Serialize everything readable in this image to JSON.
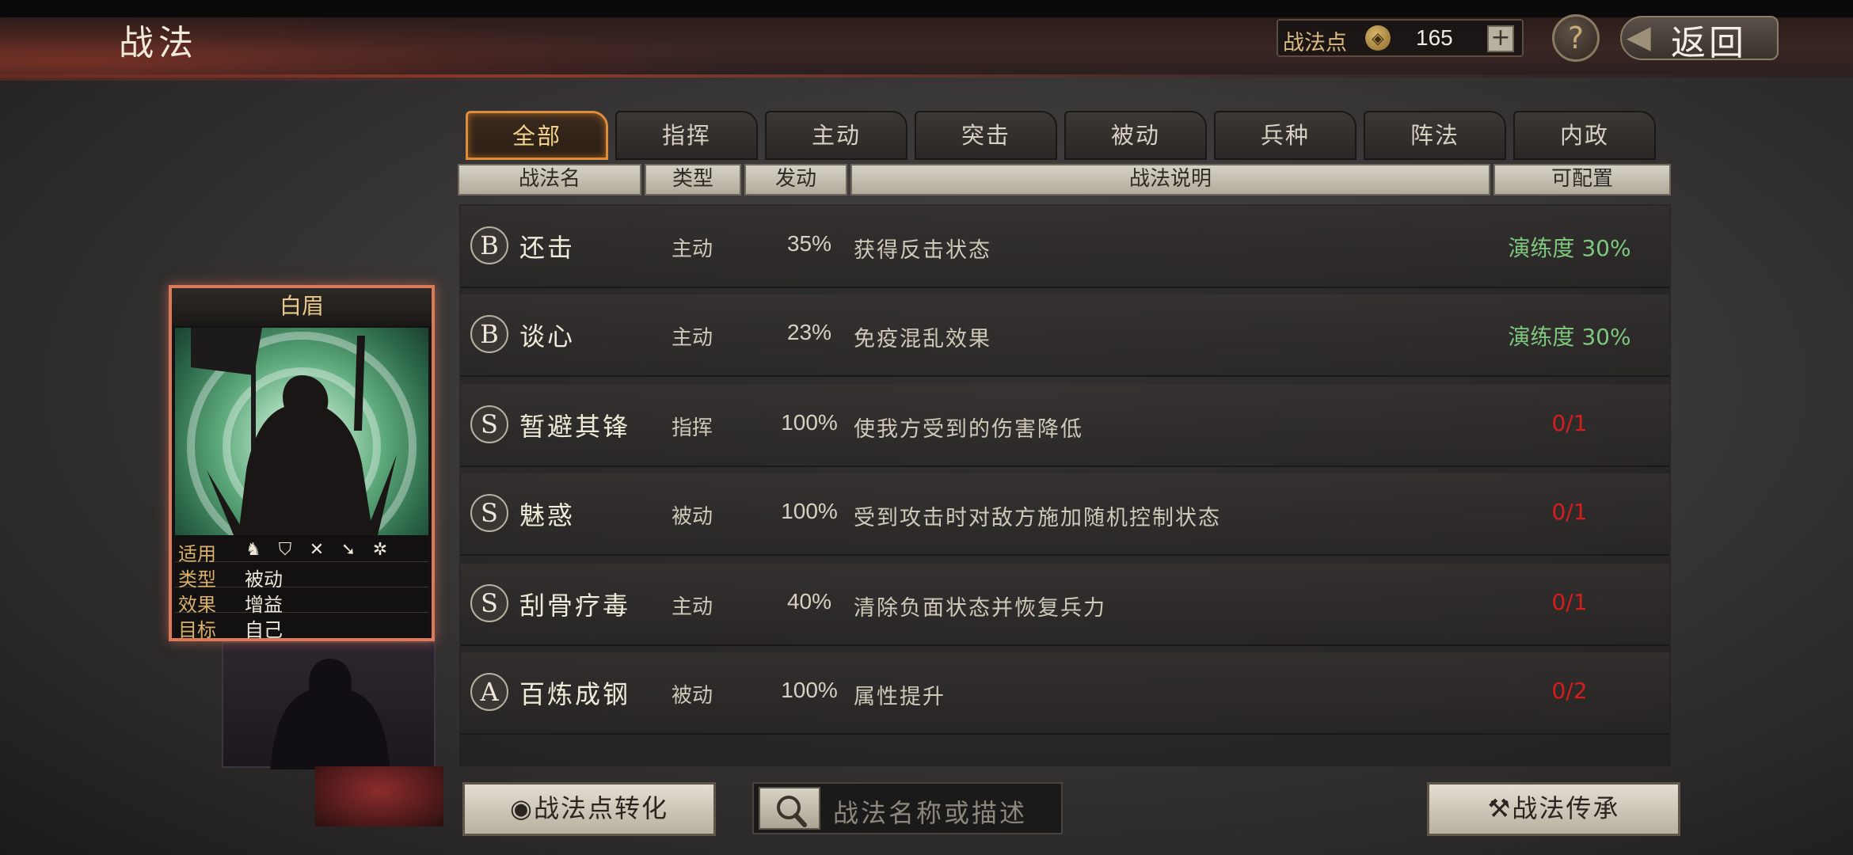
{
  "header": {
    "title": "战法",
    "points_label": "战法点",
    "points_value": "165",
    "plus_label": "+",
    "help_label": "?",
    "back_label": "返回"
  },
  "tabs": [
    {
      "label": "全部",
      "active": true
    },
    {
      "label": "指挥",
      "active": false
    },
    {
      "label": "主动",
      "active": false
    },
    {
      "label": "突击",
      "active": false
    },
    {
      "label": "被动",
      "active": false
    },
    {
      "label": "兵种",
      "active": false
    },
    {
      "label": "阵法",
      "active": false
    },
    {
      "label": "内政",
      "active": false
    }
  ],
  "columns": [
    "战法名",
    "类型",
    "发动",
    "战法说明",
    "可配置"
  ],
  "skills": [
    {
      "grade": "B",
      "name": "还击",
      "type": "主动",
      "rate": "35%",
      "desc": "获得反击状态",
      "config": "演练度 30%",
      "config_color": "green"
    },
    {
      "grade": "B",
      "name": "谈心",
      "type": "主动",
      "rate": "23%",
      "desc": "免疫混乱效果",
      "config": "演练度 30%",
      "config_color": "green"
    },
    {
      "grade": "S",
      "name": "暂避其锋",
      "type": "指挥",
      "rate": "100%",
      "desc": "使我方受到的伤害降低",
      "config": "0/1",
      "config_color": "red"
    },
    {
      "grade": "S",
      "name": "魅惑",
      "type": "被动",
      "rate": "100%",
      "desc": "受到攻击时对敌方施加随机控制状态",
      "config": "0/1",
      "config_color": "red"
    },
    {
      "grade": "S",
      "name": "刮骨疗毒",
      "type": "主动",
      "rate": "40%",
      "desc": "清除负面状态并恢复兵力",
      "config": "0/1",
      "config_color": "red"
    },
    {
      "grade": "A",
      "name": "百炼成钢",
      "type": "被动",
      "rate": "100%",
      "desc": "属性提升",
      "config": "0/2",
      "config_color": "red"
    }
  ],
  "card": {
    "name": "白眉",
    "applicable_label": "适用",
    "type_label": "类型",
    "type_value": "被动",
    "effect_label": "效果",
    "effect_value": "增益",
    "target_label": "目标",
    "target_value": "自己",
    "unit_icons": [
      "cavalry-icon",
      "shield-icon",
      "bow-icon",
      "spear-icon",
      "wheel-icon"
    ]
  },
  "bottom": {
    "convert_label": "战法点转化",
    "search_placeholder": "战法名称或描述",
    "inherit_label": "战法传承"
  },
  "colors": {
    "accent": "#e08d3a",
    "config_green": "#7ec87e",
    "config_red": "#d41e1e",
    "card_border": "#d97a5a"
  }
}
